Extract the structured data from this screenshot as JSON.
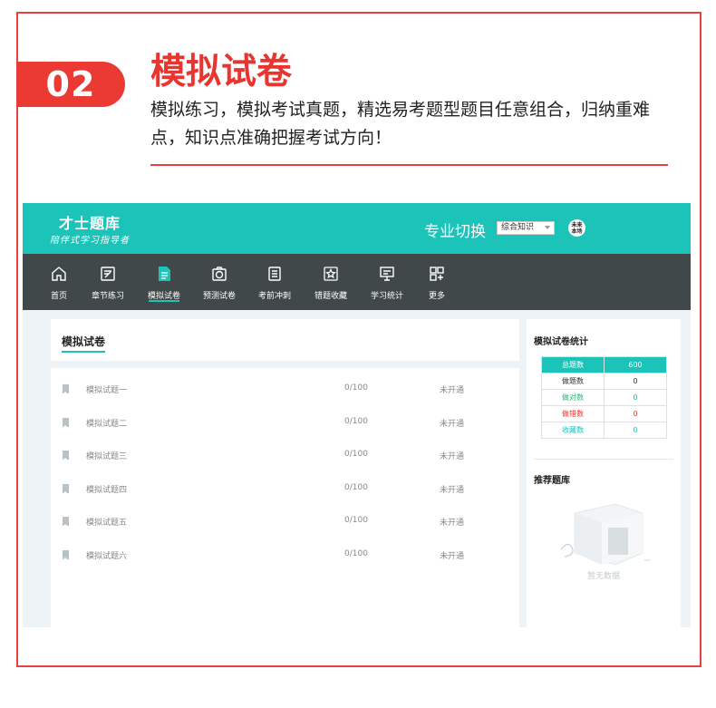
{
  "section": {
    "number": "02",
    "title": "模拟试卷",
    "description": "模拟练习，模拟考试真题，精选易考题型题目任意组合，归纳重难点，知识点准确把握考试方向！"
  },
  "app": {
    "logo": {
      "main": "才士题库",
      "sub": "陪伴式学习指导者"
    },
    "switch_label": "专业切换",
    "select_value": "综合知识",
    "avatar_text": "未来\n本场",
    "nav": [
      {
        "label": "首页",
        "icon": "home-icon"
      },
      {
        "label": "章节练习",
        "icon": "edit-icon"
      },
      {
        "label": "模拟试卷",
        "icon": "document-icon",
        "active": true
      },
      {
        "label": "预测试卷",
        "icon": "camera-icon"
      },
      {
        "label": "考前冲刺",
        "icon": "list-icon"
      },
      {
        "label": "错题收藏",
        "icon": "star-icon"
      },
      {
        "label": "学习统计",
        "icon": "presentation-icon"
      },
      {
        "label": "更多",
        "icon": "grid-plus-icon"
      }
    ],
    "panel_title": "模拟试卷",
    "papers": [
      {
        "name": "模拟试题一",
        "score": "0/100",
        "status": "未开通"
      },
      {
        "name": "模拟试题二",
        "score": "0/100",
        "status": "未开通"
      },
      {
        "name": "模拟试题三",
        "score": "0/100",
        "status": "未开通"
      },
      {
        "name": "模拟试题四",
        "score": "0/100",
        "status": "未开通"
      },
      {
        "name": "模拟试题五",
        "score": "0/100",
        "status": "未开通"
      },
      {
        "name": "模拟试题六",
        "score": "0/100",
        "status": "未开通"
      }
    ],
    "stats_title": "模拟试卷统计",
    "stats": [
      {
        "label": "总题数",
        "value": "600"
      },
      {
        "label": "做题数",
        "value": "0"
      },
      {
        "label": "做对数",
        "value": "0"
      },
      {
        "label": "做错数",
        "value": "0"
      },
      {
        "label": "收藏数",
        "value": "0"
      }
    ],
    "stats_label_colors": [
      "#ffffff",
      "#333333",
      "#2bb673",
      "#e8352f",
      "#1cc3b8"
    ],
    "stats_value_colors": [
      "#ffffff",
      "#333333",
      "#2bb673",
      "#e8352f",
      "#1cc3b8"
    ],
    "recommend_title": "推荐题库",
    "empty_text": "暂无数据"
  },
  "colors": {
    "accent_red": "#e8352f",
    "teal": "#1cc3b8",
    "nav_bg": "#404849"
  }
}
